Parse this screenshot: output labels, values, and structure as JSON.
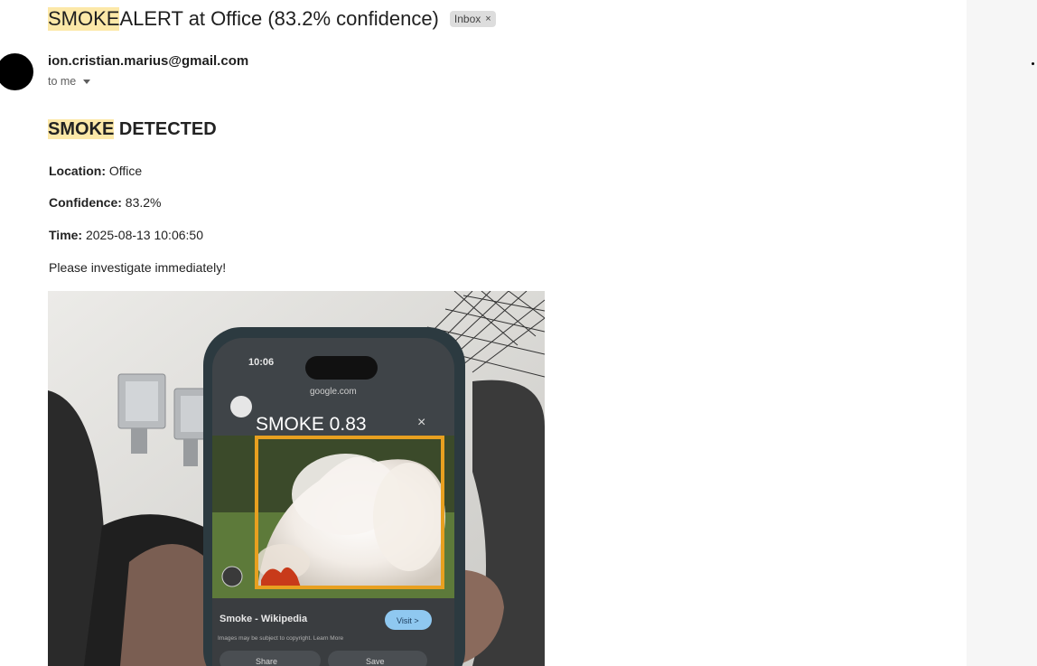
{
  "email": {
    "subject_highlight": "SMOKE",
    "subject_rest": " ALERT at Office (83.2% confidence)",
    "label_chip": "Inbox",
    "label_remove": "×",
    "sender": "ion.cristian.marius@gmail.com",
    "recipient": "to me"
  },
  "body": {
    "headline_highlight": "SMOKE",
    "headline_rest": " DETECTED",
    "location_label": "Location:",
    "location_value": " Office",
    "confidence_label": "Confidence:",
    "confidence_value": " 83.2%",
    "time_label": "Time:",
    "time_value": " 2025-08-13 10:06:50",
    "note": "Please investigate immediately!"
  },
  "snapshot": {
    "detection_label": "SMOKE 0.83",
    "phone_time": "10:06",
    "phone_url": "google.com",
    "page_title": "Smoke - Wikipedia",
    "visit_button": "Visit >",
    "copyright_note": "Images may be subject to copyright. Learn More",
    "share_button": "Share",
    "save_button": "Save",
    "box_color": "#e8a020"
  }
}
